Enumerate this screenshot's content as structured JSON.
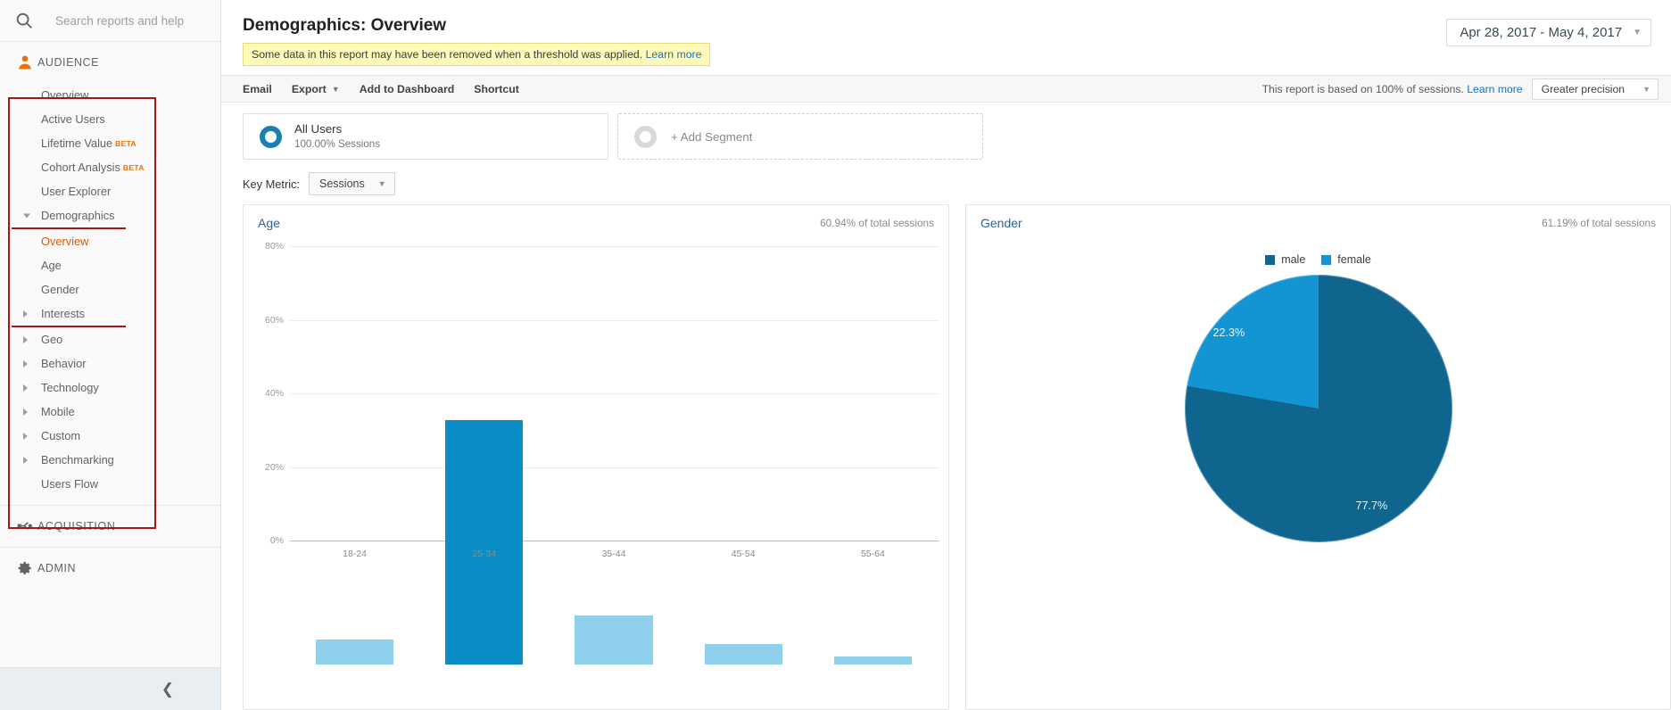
{
  "sidebar": {
    "search": {
      "placeholder": "Search reports and help",
      "icon": "search-icon"
    },
    "sections": [
      {
        "id": "audience",
        "label": "AUDIENCE",
        "icon": "person-icon",
        "items": [
          {
            "label": "Overview",
            "expandable": false,
            "badge": "",
            "selected": false
          },
          {
            "label": "Active Users",
            "expandable": false,
            "badge": "",
            "selected": false
          },
          {
            "label": "Lifetime Value",
            "expandable": false,
            "badge": "BETA",
            "selected": false
          },
          {
            "label": "Cohort Analysis",
            "expandable": false,
            "badge": "BETA",
            "selected": false
          },
          {
            "label": "User Explorer",
            "expandable": false,
            "badge": "",
            "selected": false
          },
          {
            "label": "Demographics",
            "expandable": true,
            "badge": "",
            "selected": false,
            "open": true
          },
          {
            "label": "Overview",
            "expandable": false,
            "badge": "",
            "selected": true,
            "sub": true
          },
          {
            "label": "Age",
            "expandable": false,
            "badge": "",
            "selected": false,
            "sub": true
          },
          {
            "label": "Gender",
            "expandable": false,
            "badge": "",
            "selected": false,
            "sub": true
          },
          {
            "label": "Interests",
            "expandable": true,
            "badge": "",
            "selected": false
          },
          {
            "label": "Geo",
            "expandable": true,
            "badge": "",
            "selected": false
          },
          {
            "label": "Behavior",
            "expandable": true,
            "badge": "",
            "selected": false
          },
          {
            "label": "Technology",
            "expandable": true,
            "badge": "",
            "selected": false
          },
          {
            "label": "Mobile",
            "expandable": true,
            "badge": "",
            "selected": false
          },
          {
            "label": "Custom",
            "expandable": true,
            "badge": "",
            "selected": false
          },
          {
            "label": "Benchmarking",
            "expandable": true,
            "badge": "",
            "selected": false
          },
          {
            "label": "Users Flow",
            "expandable": false,
            "badge": "",
            "selected": false
          }
        ]
      },
      {
        "id": "acquisition",
        "label": "ACQUISITION",
        "icon": "acquisition-icon",
        "items": []
      },
      {
        "id": "admin",
        "label": "ADMIN",
        "icon": "gear-icon",
        "items": []
      }
    ],
    "collapse_icon": "chevron-left-icon",
    "annotation_color": "#a01818"
  },
  "header": {
    "title": "Demographics: Overview",
    "threshold_message": "Some data in this report may have been removed when a threshold was applied.",
    "threshold_link": "Learn more",
    "date_range": "Apr 28, 2017 - May 4, 2017",
    "date_caret_icon": "chevron-down-icon"
  },
  "toolbar": {
    "email_label": "Email",
    "export_label": "Export",
    "add_to_dashboard_label": "Add to Dashboard",
    "shortcut_label": "Shortcut",
    "sampling_note": "This report is based on 100% of sessions.",
    "sampling_link": "Learn more",
    "precision_label": "Greater precision",
    "caret_icon": "chevron-down-icon"
  },
  "segments": {
    "active": {
      "name": "All Users",
      "sub": "100.00% Sessions",
      "donut_color": "#1a7fb5"
    },
    "add": {
      "label": "+ Add Segment",
      "donut_color": "#d8d8d8"
    }
  },
  "key_metric": {
    "label": "Key Metric:",
    "value": "Sessions",
    "caret_icon": "chevron-down-icon"
  },
  "panels": {
    "age": {
      "title": "Age",
      "subtitle": "60.94% of total sessions"
    },
    "gender": {
      "title": "Gender",
      "subtitle": "61.19% of total sessions"
    }
  },
  "chart_data": [
    {
      "type": "bar",
      "title": "Age",
      "categories": [
        "18-24",
        "25-34",
        "35-44",
        "45-54",
        "55-64"
      ],
      "values": [
        6.7,
        66.5,
        13.4,
        5.6,
        2.2
      ],
      "highlighted_index": 1,
      "bar_color": "#8ed0ec",
      "highlight_color": "#0a8cc4",
      "xlabel": "",
      "ylabel": "",
      "ylim": [
        0,
        80
      ],
      "yticks": [
        0,
        20,
        40,
        60,
        80
      ],
      "ytick_labels": [
        "0%",
        "20%",
        "40%",
        "60%",
        "80%"
      ],
      "grid": true,
      "legend": "none"
    },
    {
      "type": "pie",
      "title": "Gender",
      "labels": [
        "male",
        "female"
      ],
      "values": [
        77.7,
        22.3
      ],
      "value_labels": [
        "77.7%",
        "22.3%"
      ],
      "colors": [
        "#10658f",
        "#1295d2"
      ],
      "legend_position": "top"
    }
  ]
}
